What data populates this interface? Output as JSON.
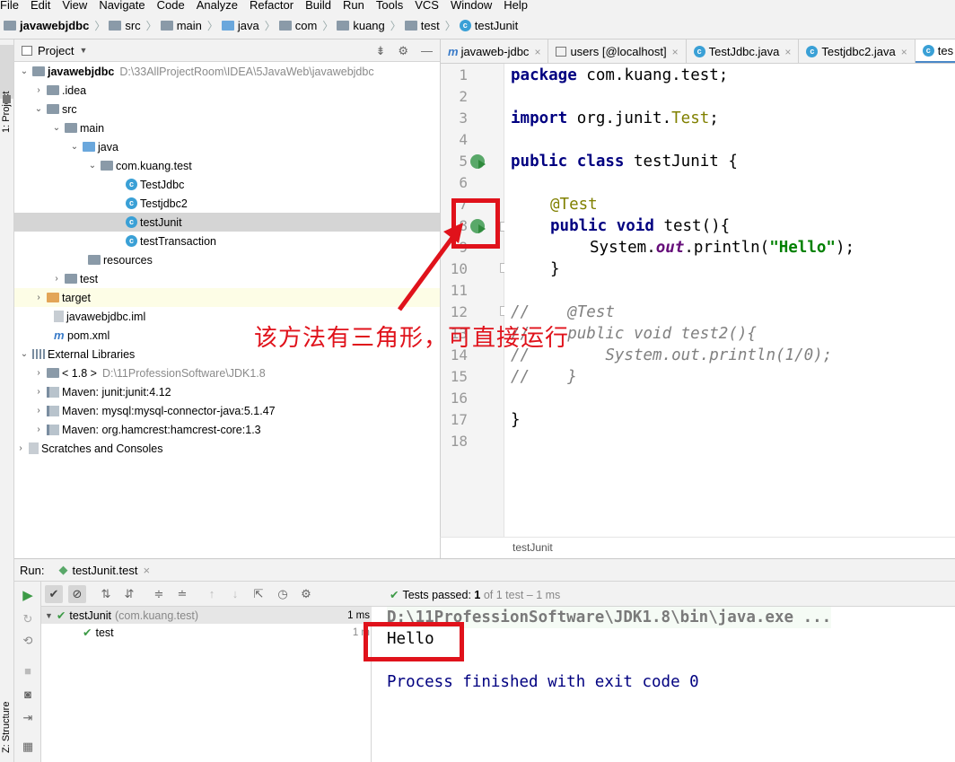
{
  "menu": [
    "File",
    "Edit",
    "View",
    "Navigate",
    "Code",
    "Analyze",
    "Refactor",
    "Build",
    "Run",
    "Tools",
    "VCS",
    "Window",
    "Help"
  ],
  "breadcrumb": [
    "javawebjdbc",
    "src",
    "main",
    "java",
    "com",
    "kuang",
    "test",
    "testJunit"
  ],
  "sidebar": {
    "project_label": "1: Project",
    "structure_label": "Z: Structure"
  },
  "project_panel": {
    "title": "Project",
    "tree": [
      {
        "label": "javawebjdbc",
        "path": "D:\\33AllProjectRoom\\IDEA\\5JavaWeb\\javawebjdbc"
      },
      {
        "label": ".idea"
      },
      {
        "label": "src"
      },
      {
        "label": "main"
      },
      {
        "label": "java"
      },
      {
        "label": "com.kuang.test"
      },
      {
        "label": "TestJdbc"
      },
      {
        "label": "Testjdbc2"
      },
      {
        "label": "testJunit"
      },
      {
        "label": "testTransaction"
      },
      {
        "label": "resources"
      },
      {
        "label": "test"
      },
      {
        "label": "target"
      },
      {
        "label": "javawebjdbc.iml"
      },
      {
        "label": "pom.xml"
      },
      {
        "label": "External Libraries"
      },
      {
        "label": "< 1.8 >",
        "path": "D:\\11ProfessionSoftware\\JDK1.8"
      },
      {
        "label": "Maven: junit:junit:4.12"
      },
      {
        "label": "Maven: mysql:mysql-connector-java:5.1.47"
      },
      {
        "label": "Maven: org.hamcrest:hamcrest-core:1.3"
      },
      {
        "label": "Scratches and Consoles"
      }
    ]
  },
  "editor": {
    "tabs": [
      "javaweb-jdbc",
      "users [@localhost]",
      "TestJdbc.java",
      "Testjdbc2.java",
      "tes"
    ],
    "line_numbers": [
      "1",
      "2",
      "3",
      "4",
      "5",
      "6",
      "7",
      "8",
      "9",
      "10",
      "11",
      "12",
      "13",
      "14",
      "15",
      "16",
      "17",
      "18"
    ],
    "code": {
      "l1_kw": "package",
      "l1_rest": " com.kuang.test;",
      "l3_kw": "import",
      "l3_rest": " org.junit.",
      "l3_cls": "Test",
      ";": ";",
      "l5_kw": "public class",
      "l5_rest": " testJunit {",
      "l7_an": "@Test",
      "l8_kw": "public void",
      "l8_rest": " test(){",
      "l9_a": "System.",
      "l9_out": "out",
      "l9_b": ".println(",
      "l9_str": "\"Hello\"",
      "l9_c": ");",
      "l10": "}",
      "l12": "//    @Test",
      "l13": "//    public void test2(){",
      "l14": "//        System.out.println(1/0);",
      "l15": "//    }",
      "l17": "}"
    },
    "footer_crumb": "testJunit"
  },
  "annotation": "该方法有三角形，可直接运行",
  "run_panel": {
    "label": "Run:",
    "tab": "testJunit.test",
    "status_prefix": "Tests passed:",
    "status_count": "1",
    "status_rest": "of 1 test – 1 ms",
    "tests": [
      {
        "name": "testJunit",
        "detail": "(com.kuang.test)",
        "time": "1 ms"
      },
      {
        "name": "test",
        "time": "1 m"
      }
    ],
    "console": [
      "D:\\11ProfessionSoftware\\JDK1.8\\bin\\java.exe ...",
      "Hello",
      "Process finished with exit code 0"
    ]
  },
  "colors": {
    "highlight_red": "#e0121b",
    "accent_blue": "#4a88c7",
    "pass_green": "#3c9a46"
  }
}
